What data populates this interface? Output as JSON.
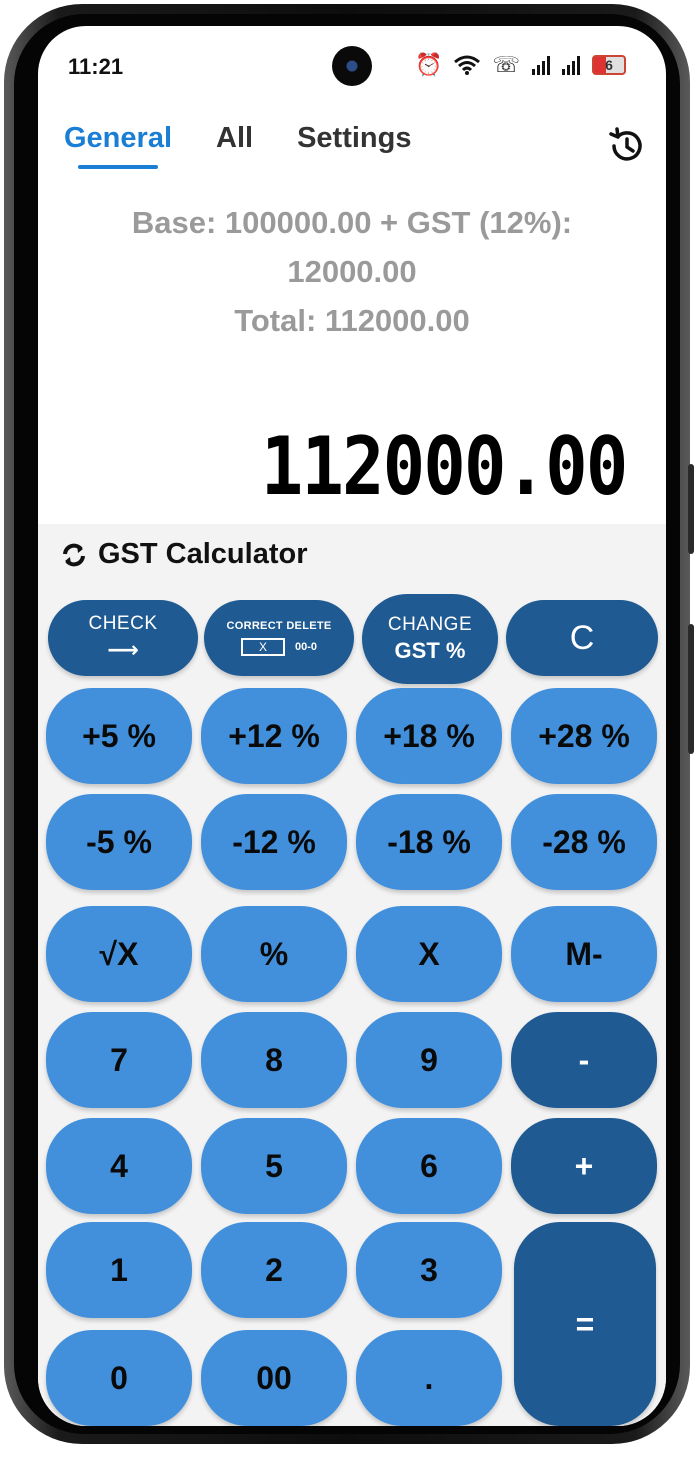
{
  "status_bar": {
    "time": "11:21",
    "battery_level": "6"
  },
  "tabs": [
    {
      "label": "General",
      "active": true
    },
    {
      "label": "All",
      "active": false
    },
    {
      "label": "Settings",
      "active": false
    }
  ],
  "summary": {
    "line1": "Base: 100000.00 + GST (12%):",
    "line2": "12000.00",
    "line3": "Total: 112000.00"
  },
  "display": {
    "value": "112000.00"
  },
  "keypad": {
    "title": "GST Calculator",
    "controls": {
      "check_label": "CHECK",
      "check_arrow": "⟶",
      "correct_delete_label": "CORRECT DELETE",
      "correct_delete_box": "X",
      "correct_delete_hint": "00-0",
      "change_line1": "CHANGE",
      "change_line2": "GST %",
      "clear_label": "C"
    },
    "gst_add": [
      "+5 %",
      "+12 %",
      "+18 %",
      "+28 %"
    ],
    "gst_sub": [
      "-5 %",
      "-12 %",
      "-18 %",
      "-28 %"
    ],
    "func_row": [
      "√X",
      "%",
      "X",
      "M-"
    ],
    "row_789": [
      "7",
      "8",
      "9",
      "-"
    ],
    "row_456": [
      "4",
      "5",
      "6",
      "+"
    ],
    "row_123": [
      "1",
      "2",
      "3"
    ],
    "row_0": [
      "0",
      "00",
      "."
    ],
    "equals": "="
  },
  "colors": {
    "accent": "#1a7fd4",
    "key_light": "#4290dc",
    "key_dark": "#1f5a92",
    "summary_text": "#9a9a9a"
  },
  "icons": {
    "history": "history-icon",
    "refresh": "refresh-icon",
    "alarm": "alarm-icon",
    "wifi": "wifi-icon",
    "call": "call-icon"
  }
}
